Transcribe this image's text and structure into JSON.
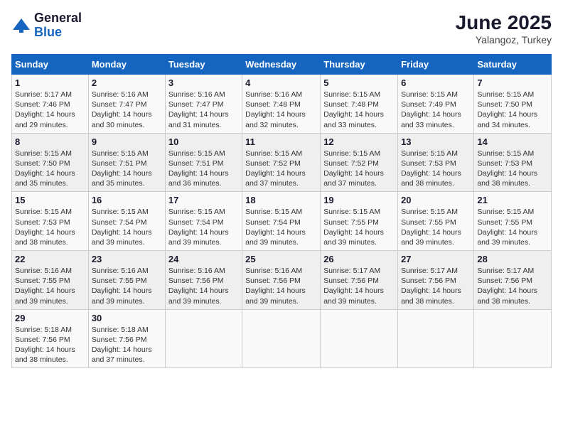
{
  "logo": {
    "general": "General",
    "blue": "Blue"
  },
  "title": {
    "month_year": "June 2025",
    "location": "Yalangoz, Turkey"
  },
  "weekdays": [
    "Sunday",
    "Monday",
    "Tuesday",
    "Wednesday",
    "Thursday",
    "Friday",
    "Saturday"
  ],
  "weeks": [
    [
      {
        "day": "1",
        "sunrise": "5:17 AM",
        "sunset": "7:46 PM",
        "daylight": "14 hours and 29 minutes."
      },
      {
        "day": "2",
        "sunrise": "5:16 AM",
        "sunset": "7:47 PM",
        "daylight": "14 hours and 30 minutes."
      },
      {
        "day": "3",
        "sunrise": "5:16 AM",
        "sunset": "7:47 PM",
        "daylight": "14 hours and 31 minutes."
      },
      {
        "day": "4",
        "sunrise": "5:16 AM",
        "sunset": "7:48 PM",
        "daylight": "14 hours and 32 minutes."
      },
      {
        "day": "5",
        "sunrise": "5:15 AM",
        "sunset": "7:48 PM",
        "daylight": "14 hours and 33 minutes."
      },
      {
        "day": "6",
        "sunrise": "5:15 AM",
        "sunset": "7:49 PM",
        "daylight": "14 hours and 33 minutes."
      },
      {
        "day": "7",
        "sunrise": "5:15 AM",
        "sunset": "7:50 PM",
        "daylight": "14 hours and 34 minutes."
      }
    ],
    [
      {
        "day": "8",
        "sunrise": "5:15 AM",
        "sunset": "7:50 PM",
        "daylight": "14 hours and 35 minutes."
      },
      {
        "day": "9",
        "sunrise": "5:15 AM",
        "sunset": "7:51 PM",
        "daylight": "14 hours and 35 minutes."
      },
      {
        "day": "10",
        "sunrise": "5:15 AM",
        "sunset": "7:51 PM",
        "daylight": "14 hours and 36 minutes."
      },
      {
        "day": "11",
        "sunrise": "5:15 AM",
        "sunset": "7:52 PM",
        "daylight": "14 hours and 37 minutes."
      },
      {
        "day": "12",
        "sunrise": "5:15 AM",
        "sunset": "7:52 PM",
        "daylight": "14 hours and 37 minutes."
      },
      {
        "day": "13",
        "sunrise": "5:15 AM",
        "sunset": "7:53 PM",
        "daylight": "14 hours and 38 minutes."
      },
      {
        "day": "14",
        "sunrise": "5:15 AM",
        "sunset": "7:53 PM",
        "daylight": "14 hours and 38 minutes."
      }
    ],
    [
      {
        "day": "15",
        "sunrise": "5:15 AM",
        "sunset": "7:53 PM",
        "daylight": "14 hours and 38 minutes."
      },
      {
        "day": "16",
        "sunrise": "5:15 AM",
        "sunset": "7:54 PM",
        "daylight": "14 hours and 39 minutes."
      },
      {
        "day": "17",
        "sunrise": "5:15 AM",
        "sunset": "7:54 PM",
        "daylight": "14 hours and 39 minutes."
      },
      {
        "day": "18",
        "sunrise": "5:15 AM",
        "sunset": "7:54 PM",
        "daylight": "14 hours and 39 minutes."
      },
      {
        "day": "19",
        "sunrise": "5:15 AM",
        "sunset": "7:55 PM",
        "daylight": "14 hours and 39 minutes."
      },
      {
        "day": "20",
        "sunrise": "5:15 AM",
        "sunset": "7:55 PM",
        "daylight": "14 hours and 39 minutes."
      },
      {
        "day": "21",
        "sunrise": "5:15 AM",
        "sunset": "7:55 PM",
        "daylight": "14 hours and 39 minutes."
      }
    ],
    [
      {
        "day": "22",
        "sunrise": "5:16 AM",
        "sunset": "7:55 PM",
        "daylight": "14 hours and 39 minutes."
      },
      {
        "day": "23",
        "sunrise": "5:16 AM",
        "sunset": "7:55 PM",
        "daylight": "14 hours and 39 minutes."
      },
      {
        "day": "24",
        "sunrise": "5:16 AM",
        "sunset": "7:56 PM",
        "daylight": "14 hours and 39 minutes."
      },
      {
        "day": "25",
        "sunrise": "5:16 AM",
        "sunset": "7:56 PM",
        "daylight": "14 hours and 39 minutes."
      },
      {
        "day": "26",
        "sunrise": "5:17 AM",
        "sunset": "7:56 PM",
        "daylight": "14 hours and 39 minutes."
      },
      {
        "day": "27",
        "sunrise": "5:17 AM",
        "sunset": "7:56 PM",
        "daylight": "14 hours and 38 minutes."
      },
      {
        "day": "28",
        "sunrise": "5:17 AM",
        "sunset": "7:56 PM",
        "daylight": "14 hours and 38 minutes."
      }
    ],
    [
      {
        "day": "29",
        "sunrise": "5:18 AM",
        "sunset": "7:56 PM",
        "daylight": "14 hours and 38 minutes."
      },
      {
        "day": "30",
        "sunrise": "5:18 AM",
        "sunset": "7:56 PM",
        "daylight": "14 hours and 37 minutes."
      },
      null,
      null,
      null,
      null,
      null
    ]
  ]
}
